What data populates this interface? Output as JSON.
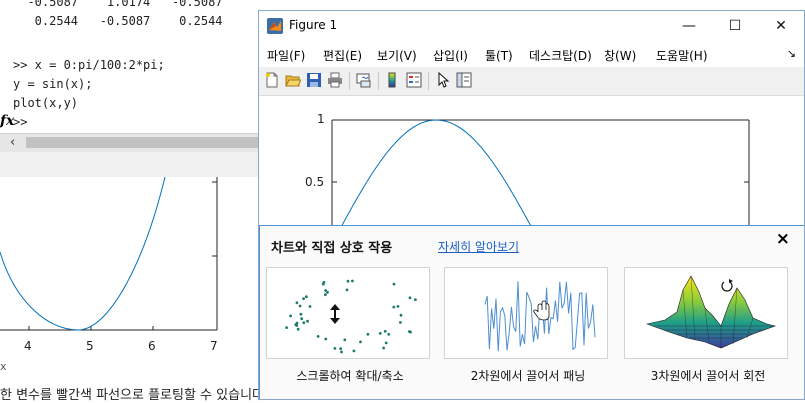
{
  "command_window": {
    "output_rows": [
      "  -0.5087    1.0174   -0.5087",
      "   0.2544   -0.5087    0.2544"
    ],
    "code_lines": [
      ">> x = 0:pi/100:2*pi;",
      "y = sin(x);",
      "plot(x,y)",
      ">>"
    ],
    "fx_symbol": "fx"
  },
  "background_plot": {
    "x_ticks": [
      "4",
      "5",
      "6",
      "7"
    ],
    "x_label": "x",
    "caption": "한 변수를 빨간색 파선으로 플로팅할 수 있습니다"
  },
  "figure": {
    "title": "Figure 1",
    "menu": [
      "파일(F)",
      "편집(E)",
      "보기(V)",
      "삽입(I)",
      "툴(T)",
      "데스크탑(D)",
      "창(W)",
      "도움말(H)"
    ],
    "window_buttons": [
      "—",
      "☐",
      "✕"
    ],
    "toolbar_icons": [
      "new-figure-icon",
      "open-file-icon",
      "save-icon",
      "print-icon",
      "link-plot-icon",
      "colorbar-icon",
      "legend-icon",
      "edit-plot-icon",
      "property-inspector-icon"
    ]
  },
  "chart_data": {
    "type": "line",
    "function": "y = sin(x)",
    "x_range": [
      0,
      6.2832
    ],
    "y_ticks": [
      "1",
      "0.5"
    ],
    "line_color": "#0072BD"
  },
  "interaction_panel": {
    "title": "차트와 직접 상호 작용",
    "learn_more_link": "자세히 알아보기",
    "close_label": "×",
    "cards": [
      {
        "caption": "스크롤하여 확대/축소"
      },
      {
        "caption": "2차원에서 끌어서 패닝"
      },
      {
        "caption": "3차원에서 끌어서 회전"
      }
    ]
  }
}
